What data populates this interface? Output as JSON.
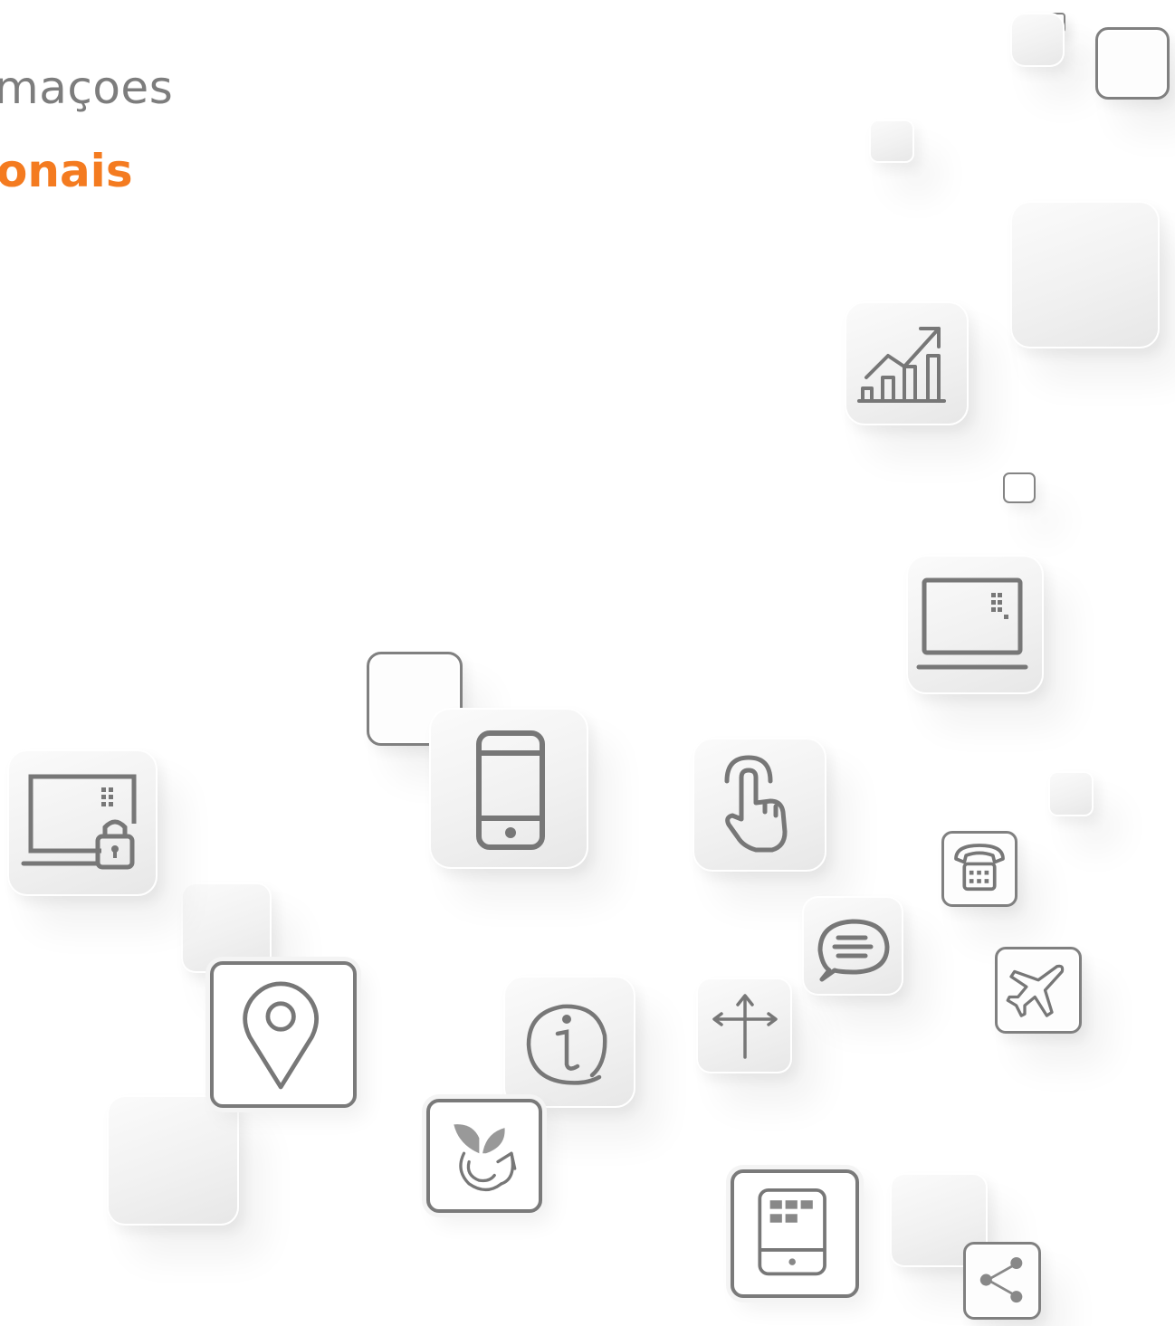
{
  "heading": {
    "line1": "maçoes",
    "line2": "onais"
  },
  "colors": {
    "accent": "#f47b20",
    "title_gray": "#7d7d7d",
    "icon_gray": "#7a7a7a",
    "tile_light": "#f1f1f1"
  },
  "icons": [
    "chart-growth-icon",
    "laptop-icon",
    "laptop-lock-icon",
    "smartphone-icon",
    "touch-hand-icon",
    "telephone-icon",
    "chat-bubble-icon",
    "airplane-icon",
    "location-pin-icon",
    "info-icon",
    "directions-arrows-icon",
    "plant-recycle-icon",
    "tablet-icon",
    "share-icon"
  ]
}
